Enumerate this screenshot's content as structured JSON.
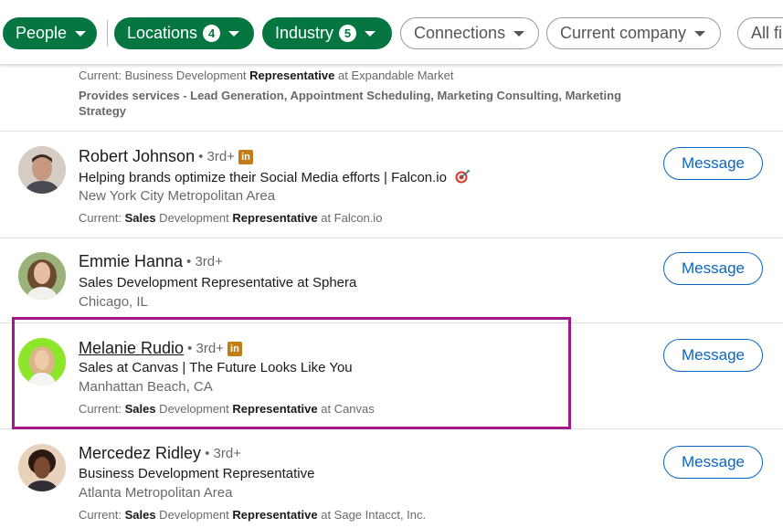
{
  "filters": {
    "people": {
      "label": "People"
    },
    "locations": {
      "label": "Locations",
      "count": "4"
    },
    "industry": {
      "label": "Industry",
      "count": "5"
    },
    "connections": {
      "label": "Connections"
    },
    "current_company": {
      "label": "Current company"
    },
    "all_filters": {
      "label": "All fi"
    }
  },
  "previous_result": {
    "current_prefix": "Current: Business Development ",
    "current_role_bold": "Representative",
    "current_suffix": " at Expandable Market",
    "summary": "Provides services - Lead Generation, Appointment Scheduling, Marketing Consulting, Marketing Strategy"
  },
  "people": [
    {
      "name": "Robert Johnson",
      "degree": "• 3rd+",
      "linkedin_premium": true,
      "headline": "Helping brands optimize their Social Media efforts | Falcon.io",
      "location": "New York City Metropolitan Area",
      "current_label": "Current: ",
      "current_bold1": "Sales",
      "current_mid": " Development ",
      "current_bold2": "Representative",
      "current_suffix": " at Falcon.io",
      "action": "Message"
    },
    {
      "name": "Emmie Hanna",
      "degree": "• 3rd+",
      "linkedin_premium": false,
      "headline": "Sales Development Representative at Sphera",
      "location": "Chicago, IL",
      "action": "Message"
    },
    {
      "name": "Melanie Rudio",
      "degree": "• 3rd+",
      "linkedin_premium": true,
      "headline": "Sales at Canvas | The Future Looks Like You",
      "location": "Manhattan Beach, CA",
      "current_label": "Current: ",
      "current_bold1": "Sales",
      "current_mid": " Development ",
      "current_bold2": "Representative",
      "current_suffix": " at Canvas",
      "action": "Message",
      "highlighted": true
    },
    {
      "name": "Mercedez Ridley",
      "degree": "• 3rd+",
      "linkedin_premium": false,
      "headline": "Business Development Representative",
      "location": "Atlanta Metropolitan Area",
      "current_label": "Current: ",
      "current_bold1": "Sales",
      "current_mid": " Development ",
      "current_bold2": "Representative",
      "current_suffix": " at Sage Intacct, Inc.",
      "action": "Message"
    }
  ],
  "badge_text": "in",
  "colors": {
    "filter_active": "#057642",
    "message_button": "#0a66c2",
    "highlight_border": "#a0178a",
    "premium_badge": "#c37d16"
  }
}
